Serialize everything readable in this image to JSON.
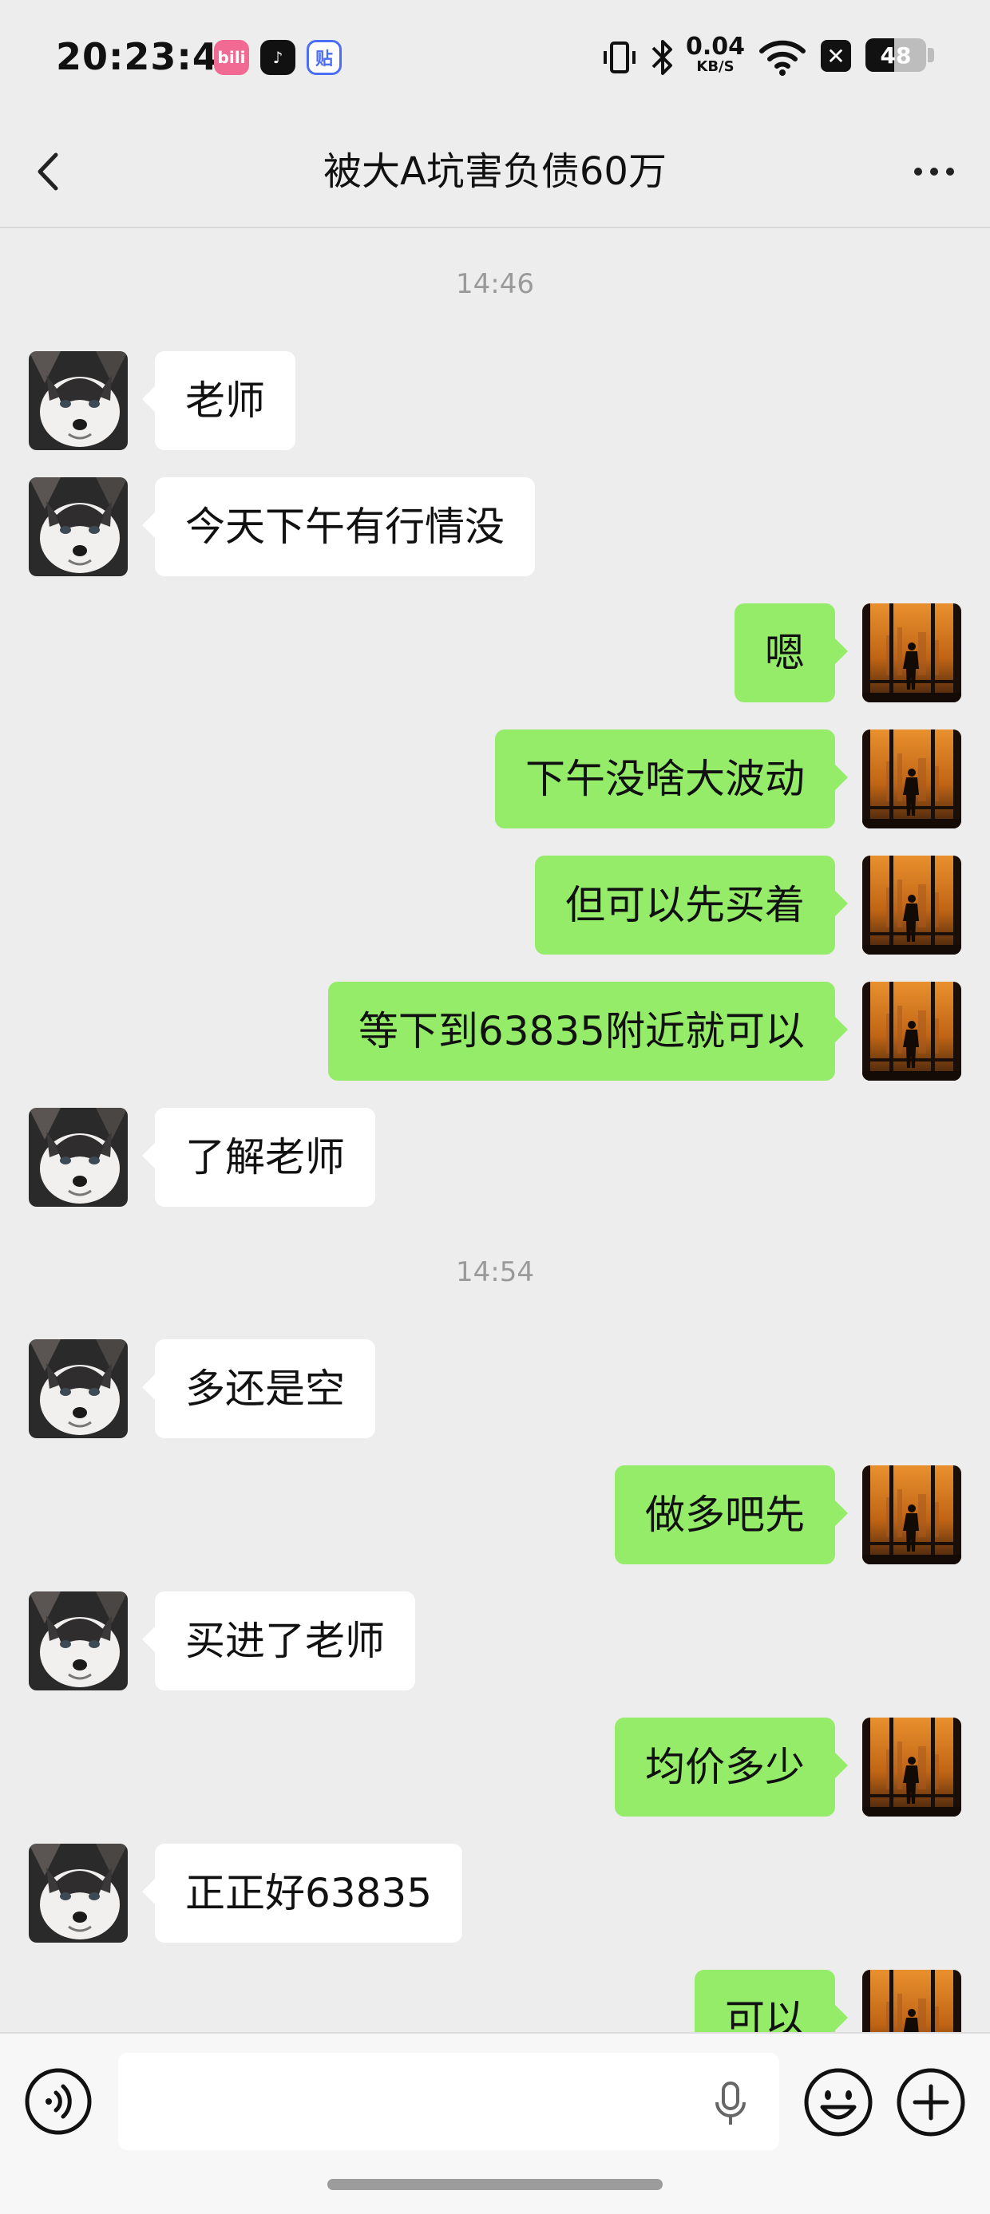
{
  "status_bar": {
    "time": "20:23:41",
    "apps": [
      {
        "name": "bilibili-app-icon",
        "label": "bili"
      },
      {
        "name": "tiktok-app-icon",
        "label": "♪"
      },
      {
        "name": "tieba-app-icon",
        "label": "贴"
      }
    ],
    "net_speed": "0.04",
    "net_unit": "KB/S",
    "battery_level": "48",
    "battery_fraction": 0.48
  },
  "header": {
    "title": "被大A坑害负债60万"
  },
  "chat": {
    "timestamps": [
      "14:46",
      "14:54"
    ],
    "messages": [
      {
        "side": "in",
        "text": "老师"
      },
      {
        "side": "in",
        "text": "今天下午有行情没"
      },
      {
        "side": "out",
        "text": "嗯"
      },
      {
        "side": "out",
        "text": "下午没啥大波动"
      },
      {
        "side": "out",
        "text": "但可以先买着"
      },
      {
        "side": "out",
        "text": "等下到63835附近就可以"
      },
      {
        "side": "in",
        "text": "了解老师"
      },
      {
        "side": "in",
        "text": "多还是空"
      },
      {
        "side": "out",
        "text": "做多吧先"
      },
      {
        "side": "in",
        "text": "买进了老师"
      },
      {
        "side": "out",
        "text": "均价多少"
      },
      {
        "side": "in",
        "text": "正正好63835"
      },
      {
        "side": "out",
        "text": "可以"
      }
    ]
  },
  "input_bar": {
    "message_input_value": ""
  },
  "colors": {
    "background": "#ededed",
    "incoming_bubble": "#ffffff",
    "outgoing_bubble": "#95ec69",
    "timestamp": "#9a9a9a"
  }
}
